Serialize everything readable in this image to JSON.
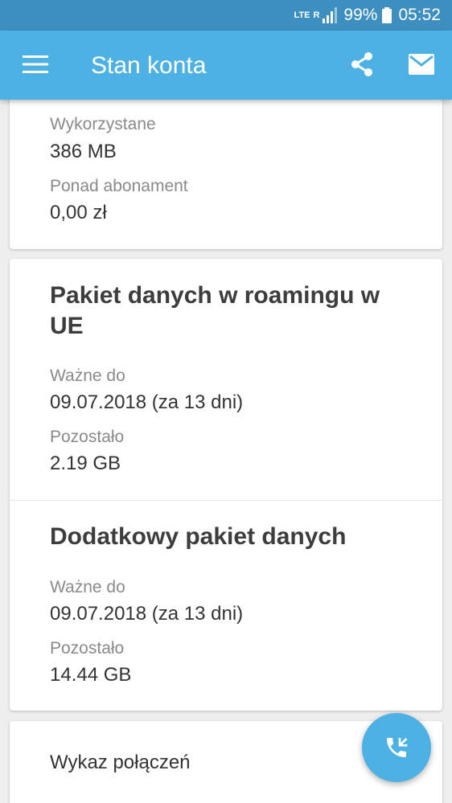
{
  "status_bar": {
    "network_label": "LTE",
    "roaming_label": "R",
    "battery": "99%",
    "time": "05:52"
  },
  "app_bar": {
    "title": "Stan konta",
    "menu_icon": "hamburger-icon",
    "share_icon": "share-icon",
    "mail_icon": "mail-icon"
  },
  "usage_card": {
    "used_label": "Wykorzystane",
    "used_value": "386 MB",
    "over_label": "Ponad abonament",
    "over_value": "0,00 zł"
  },
  "packages": [
    {
      "title": "Pakiet danych w roamingu w UE",
      "valid_label": "Ważne do",
      "valid_value": "09.07.2018 (za 13 dni)",
      "remaining_label": "Pozostało",
      "remaining_value": "2.19 GB"
    },
    {
      "title": "Dodatkowy pakiet danych",
      "valid_label": "Ważne do",
      "valid_value": "09.07.2018 (za 13 dni)",
      "remaining_label": "Pozostało",
      "remaining_value": "14.44 GB"
    }
  ],
  "calls_card": {
    "label": "Wykaz połączeń"
  },
  "fab": {
    "icon": "phone-calls-icon"
  },
  "colors": {
    "status_bar": "#3d8fbf",
    "app_bar": "#4db1e3",
    "accent": "#4db1e3",
    "background": "#eeeeee"
  }
}
